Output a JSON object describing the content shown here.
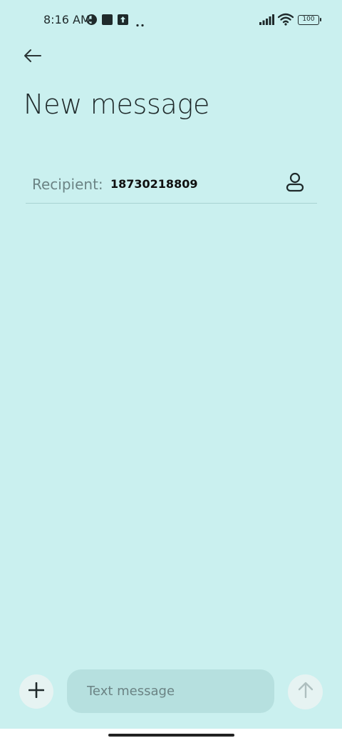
{
  "status_bar": {
    "time": "8:16 AM",
    "battery_level": "100",
    "icons": [
      "data-saver-icon",
      "square-notification-icon",
      "upload-notification-icon",
      "more-notifications-icon",
      "signal-icon",
      "wifi-icon",
      "battery-icon"
    ]
  },
  "header": {
    "back_icon": "arrow-left-icon",
    "title": "New message"
  },
  "recipient": {
    "label": "Recipient:",
    "value": "18730218809",
    "contact_icon": "person-icon"
  },
  "compose": {
    "attach_icon": "plus-icon",
    "placeholder": "Text message",
    "value": "",
    "send_icon": "arrow-up-icon"
  },
  "colors": {
    "background": "#caf0ef",
    "input_background": "#b6e0df",
    "button_background": "#e6f3f2",
    "text": "#1f2a2b",
    "muted_text": "#6b8384"
  }
}
